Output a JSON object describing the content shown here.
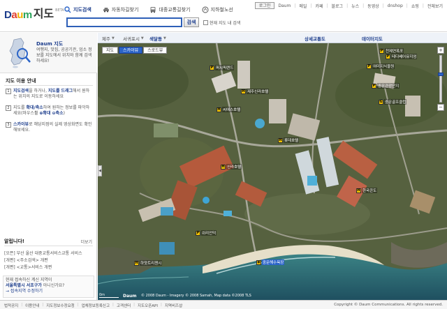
{
  "header": {
    "logo": {
      "brand": "Daum",
      "title": "지도",
      "beta": "BETA"
    },
    "tabs": [
      {
        "label": "지도검색",
        "icon": "search-icon"
      },
      {
        "label": "자동차길찾기",
        "icon": "car-icon"
      },
      {
        "label": "대중교통길찾기",
        "icon": "bus-icon"
      },
      {
        "label": "지하철노선",
        "icon": "subway-icon"
      }
    ],
    "search": {
      "value": "",
      "placeholder": "",
      "button": "검색",
      "checkbox_label": "현재 지도 내 검색"
    },
    "top_links": [
      "로그인",
      "Daum",
      "메일",
      "카페",
      "블로그",
      "뉴스",
      "동영상",
      "dnshop",
      "쇼핑",
      "전체보기"
    ]
  },
  "sidebar": {
    "intro": {
      "title": "Daum 지도",
      "desc": "여행지, 맛집, 공공기관, 업소 정보를 지도에서 위치와 함께 검색하세요!"
    },
    "guide_title": "지도 이용 안내",
    "guides": [
      {
        "num": "1",
        "pre": "",
        "b1": "지도검색",
        "mid": "을 하거나, ",
        "b2": "지도를 드래그",
        "post": "해서 원하는 위치의 지도로 이동하세요"
      },
      {
        "num": "2",
        "pre": "지도를 ",
        "b1": "확대/축소",
        "mid": "하여 원하는 정보를 파악하세요(마우스휠 ",
        "b2": "⊕확대 ⊖축소",
        "post": ")"
      },
      {
        "num": "3",
        "pre": "",
        "b1": "스카이뷰",
        "mid": "로 해당지점의 실제 영상화면도 확인해보세요.",
        "b2": "",
        "post": ""
      }
    ],
    "notice_title": "알립니다!",
    "notice_more": "더보기",
    "notices": [
      "[오픈] 부산 울산 대중교통서비스교통 서비스",
      "[개편] <주소검색> 개편",
      "[개편] <교통>서비스 개편"
    ],
    "promo": {
      "l1": "현재 접속하신 계신 지역이",
      "l2_bold": "서울특별시 서초구가",
      "l2": " 아니신가요?",
      "l3": "→ 접속지역 수정하기"
    }
  },
  "map": {
    "crumbs": [
      "제주",
      "서귀포시",
      "색달동"
    ],
    "right_links": [
      "상세교통도",
      "데이터지도"
    ],
    "view_tabs": [
      {
        "label": "지도",
        "active": false
      },
      {
        "label": "스카이뷰",
        "active": true
      },
      {
        "label": "스로드뷰",
        "active": false
      }
    ],
    "pois": [
      {
        "label": "신라호텔",
        "blue": false
      },
      {
        "label": "롯데호텔",
        "blue": false
      },
      {
        "label": "제주신라호텔",
        "blue": false
      },
      {
        "label": "하얏트리젠시",
        "blue": false
      },
      {
        "label": "한국콘도",
        "blue": false
      },
      {
        "label": "중문해수욕장",
        "blue": true
      },
      {
        "label": "퍼시픽랜드",
        "blue": false
      },
      {
        "label": "천제연폭포",
        "blue": false
      },
      {
        "label": "여미지식물원",
        "blue": false
      },
      {
        "label": "중문관광단지",
        "blue": false
      },
      {
        "label": "씨에스호텔",
        "blue": false
      },
      {
        "label": "쉬리언덕",
        "blue": false
      },
      {
        "label": "중문골프클럽",
        "blue": false
      },
      {
        "label": "테디베어뮤지엄",
        "blue": false
      }
    ],
    "copyright": "© 2008 Daum - Imagery © 2008 Samah, Map data ©2008 TLS",
    "scale": "0m",
    "zoom": {
      "plus": "+",
      "minus": "−"
    }
  },
  "footer": {
    "links": [
      "법적공지",
      "이용안내",
      "지도정보수정요청",
      "업체정보등록신고",
      "고객센터",
      "지도오픈API",
      "지역비즈샵"
    ],
    "copyright": "Copyright © Daum Communications. All rights reserved."
  },
  "colors": {
    "brand_blue": "#1c3d8c",
    "accent": "#2b64c8",
    "sea": "#2e6b78"
  }
}
